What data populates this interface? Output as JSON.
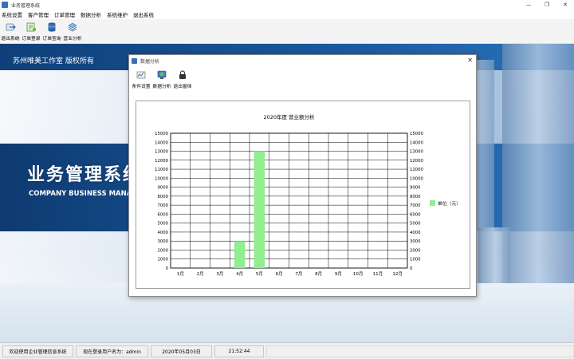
{
  "window": {
    "title": "业务管理系统",
    "controls": [
      "—",
      "❐",
      "✕"
    ]
  },
  "menu": [
    "系统设置",
    "客户管理",
    "订单管理",
    "数据分析",
    "系统维护",
    "退出系统"
  ],
  "toolbar": [
    {
      "label": "退出系统",
      "icon": "exit-icon"
    },
    {
      "label": "订单登录",
      "icon": "order-entry-icon"
    },
    {
      "label": "订单查询",
      "icon": "order-query-icon"
    },
    {
      "label": "营业分析",
      "icon": "analysis-icon"
    }
  ],
  "banner": {
    "copyright": "苏州唯美工作室 版权所有",
    "title": "业务管理系统",
    "subtitle": "COMPANY BUSINESS MANAG"
  },
  "dialog": {
    "title": "数据分析",
    "close": "✕",
    "toolbar": [
      {
        "label": "条件设置",
        "icon": "condition-icon"
      },
      {
        "label": "数据分析",
        "icon": "data-analysis-icon"
      },
      {
        "label": "退出窗体",
        "icon": "lock-icon"
      }
    ]
  },
  "chart_data": {
    "type": "bar",
    "title": "2020年度 营业额分析",
    "categories": [
      "1月",
      "2月",
      "3月",
      "4月",
      "5月",
      "6月",
      "7月",
      "8月",
      "9月",
      "10月",
      "11月",
      "12月"
    ],
    "series": [
      {
        "name": "单位（元）",
        "values": [
          0,
          0,
          0,
          3000,
          13000,
          0,
          0,
          0,
          0,
          0,
          0,
          0
        ]
      }
    ],
    "ylim": [
      0,
      15000
    ],
    "yticks": [
      0,
      1000,
      2000,
      3000,
      4000,
      5000,
      6000,
      7000,
      8000,
      9000,
      10000,
      11000,
      12000,
      13000,
      14000,
      15000
    ],
    "grid": true,
    "legend": "right",
    "bar_color": "#90ee90"
  },
  "status": {
    "welcome": "欢迎使用企业管理信息系统",
    "user": "现在登录用户名为：admin",
    "date": "2020年05月03日",
    "time": "21:52:44"
  }
}
